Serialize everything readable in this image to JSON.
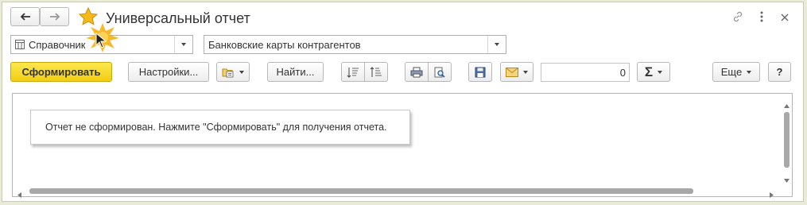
{
  "window": {
    "title": "Универсальный отчет"
  },
  "nav": {
    "back_icon": "arrow-left-icon",
    "forward_icon": "arrow-right-icon",
    "favorite_icon": "star-icon"
  },
  "header_actions": {
    "link_icon": "link-icon",
    "more_icon": "more-vertical-icon",
    "close_icon": "close-icon"
  },
  "report_type": {
    "value": "Справочник"
  },
  "report_variant": {
    "value": "Банковские карты контрагентов"
  },
  "toolbar": {
    "generate_label": "Сформировать",
    "settings_label": "Настройки...",
    "find_label": "Найти...",
    "amount_value": "0",
    "more_label": "Еще",
    "help_label": "?"
  },
  "report_area": {
    "message": "Отчет не сформирован. Нажмите \"Сформировать\" для получения отчета."
  },
  "colors": {
    "primary_button": "#f6d61c",
    "accent_star": "#f3b21b",
    "frame": "#c9cbb3"
  }
}
